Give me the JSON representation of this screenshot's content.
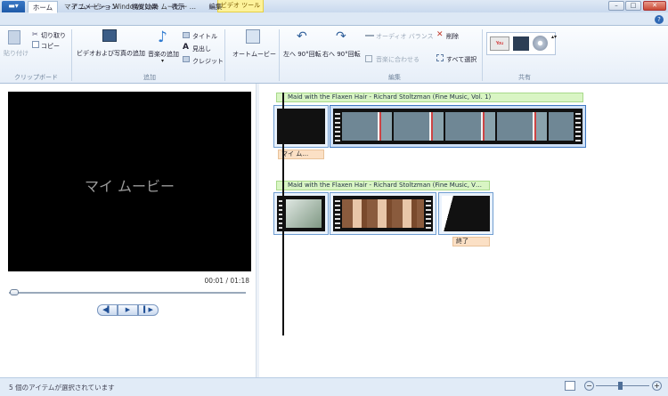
{
  "window": {
    "title": "マイ ムービー - Windows Live ムービー ...",
    "context_tab": "ビデオ ツール",
    "min": "–",
    "max": "□",
    "close": "✕"
  },
  "tabs": [
    {
      "label": "ホーム"
    },
    {
      "label": "アニメーション"
    },
    {
      "label": "視覚効果"
    },
    {
      "label": "表示"
    },
    {
      "label": "編集"
    }
  ],
  "ribbon": {
    "clipboard": {
      "paste": "貼り付け",
      "cut": "切り取り",
      "copy": "コピー",
      "group": "クリップボード"
    },
    "add": {
      "add_video": "ビデオおよび写真の追加",
      "add_music": "音楽の追加",
      "title": "タイトル",
      "caption": "見出し",
      "credits": "クレジット",
      "group": "追加"
    },
    "automovie": {
      "label": "オートムービー"
    },
    "edit": {
      "rotate_left": "左へ 90°回転",
      "rotate_right": "右へ 90°回転",
      "audio_mix": "オーディオ バランス",
      "fit_music": "音楽に合わせる",
      "delete": "削除",
      "select_all": "すべて選択",
      "group": "編集"
    },
    "share": {
      "group": "共有"
    }
  },
  "preview": {
    "title": "マイ ムービー",
    "timecode": "00:01 / 01:18"
  },
  "storyboard": {
    "row1": {
      "music": "Maid with the Flaxen Hair - Richard Stoltzman (Fine Music, Vol. 1)",
      "caption": "マイ ム…"
    },
    "row2": {
      "music": "Maid with the Flaxen Hair - Richard Stoltzman (Fine Music, V…",
      "caption": "終了"
    }
  },
  "status": {
    "text": "5 個のアイテムが選択されています"
  },
  "colors": {
    "accent": "#1e5aa8",
    "music": "#d9f5c4",
    "caption": "#fbe0c5",
    "context": "#fdf29a"
  }
}
